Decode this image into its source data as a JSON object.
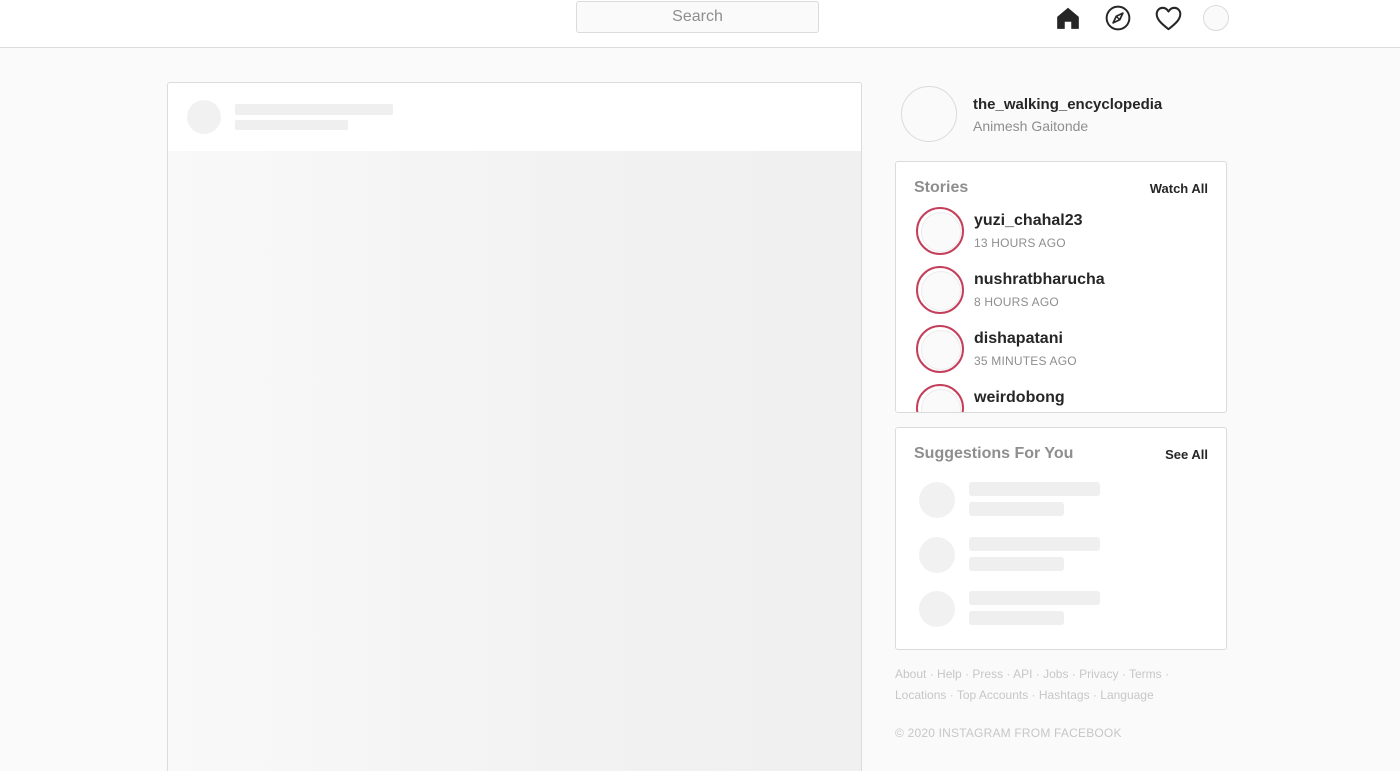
{
  "header": {
    "search_placeholder": "Search",
    "icons": [
      "home-icon",
      "explore-icon",
      "heart-icon",
      "profile-avatar"
    ]
  },
  "profile": {
    "username": "the_walking_encyclopedia",
    "full_name": "Animesh Gaitonde"
  },
  "stories": {
    "title": "Stories",
    "action": "Watch All",
    "items": [
      {
        "username": "yuzi_chahal23",
        "time": "13 HOURS AGO"
      },
      {
        "username": "nushratbharucha",
        "time": "8 HOURS AGO"
      },
      {
        "username": "dishapatani",
        "time": "35 MINUTES AGO"
      },
      {
        "username": "weirdobong",
        "time": ""
      }
    ]
  },
  "suggestions": {
    "title": "Suggestions For You",
    "action": "See All"
  },
  "footer": {
    "links": [
      "About",
      "Help",
      "Press",
      "API",
      "Jobs",
      "Privacy",
      "Terms",
      "Locations",
      "Top Accounts",
      "Hashtags",
      "Language"
    ],
    "copyright": "© 2020 INSTAGRAM FROM FACEBOOK"
  },
  "colors": {
    "story_ring": "#c33f5b",
    "border": "#dbdbdb",
    "muted_text": "#8e8e8e",
    "footer_text": "#c7c7c7"
  }
}
